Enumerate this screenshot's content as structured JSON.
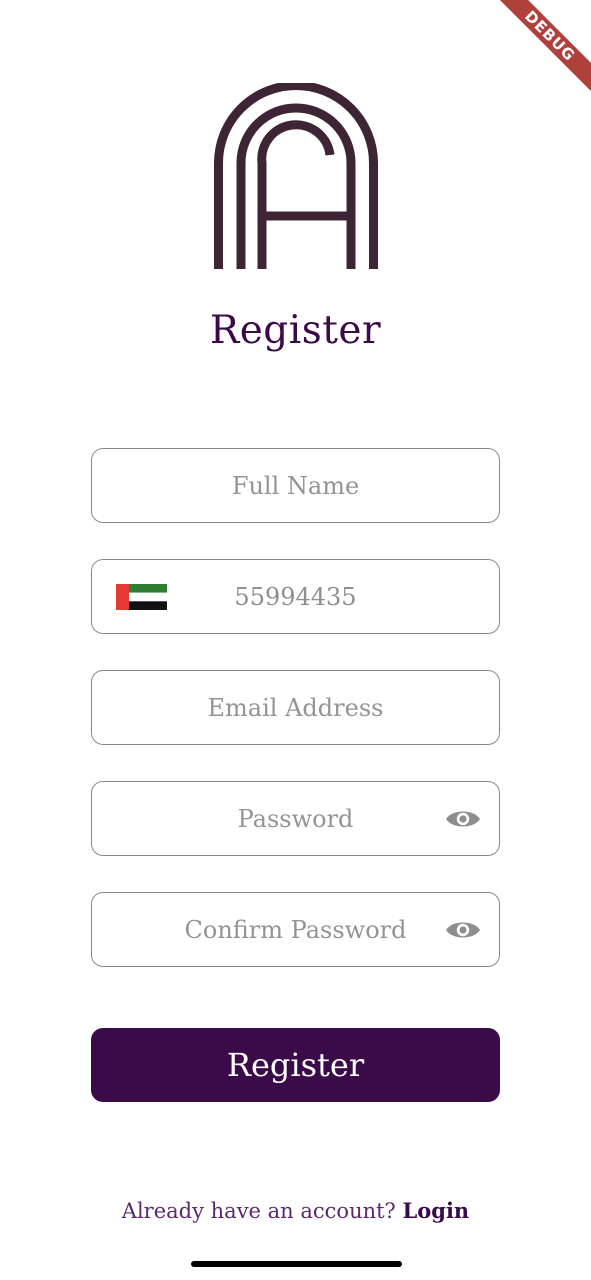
{
  "debug_banner": {
    "label": "DEBUG"
  },
  "page": {
    "title": "Register"
  },
  "form": {
    "full_name": {
      "placeholder": "Full Name",
      "value": ""
    },
    "phone": {
      "value": "55994435",
      "country": "UAE flag"
    },
    "email": {
      "placeholder": "Email Address",
      "value": ""
    },
    "password": {
      "placeholder": "Password",
      "value": ""
    },
    "confirm_password": {
      "placeholder": "Confirm Password",
      "value": ""
    }
  },
  "actions": {
    "register_label": "Register"
  },
  "footer": {
    "question": "Already have an account?",
    "login_label": "Login"
  },
  "colors": {
    "primary": "#3b0a48",
    "border": "#8a8a8a",
    "placeholder": "#949494",
    "logo": "#3d2535"
  },
  "icons": {
    "logo": "brand-logo",
    "visibility": "eye-icon",
    "flag": "uae-flag-icon"
  }
}
